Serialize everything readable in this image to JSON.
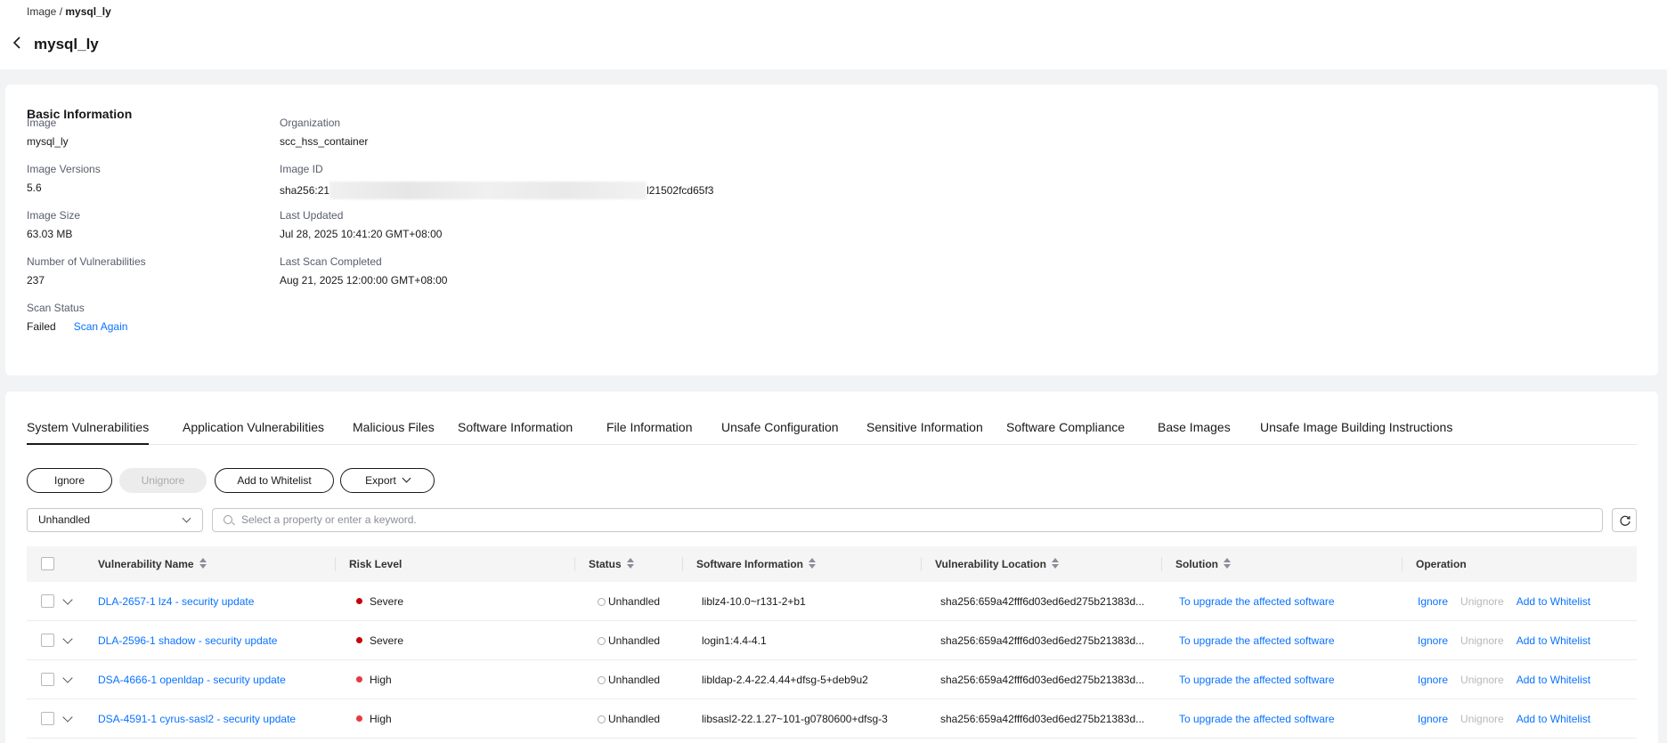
{
  "breadcrumb": {
    "parent": "Image",
    "sep": " / ",
    "current": "mysql_ly"
  },
  "page": {
    "title": "mysql_ly"
  },
  "basic_info": {
    "title": "Basic Information",
    "image": {
      "label": "Image",
      "value": "mysql_ly"
    },
    "organization": {
      "label": "Organization",
      "value": "scc_hss_container"
    },
    "image_versions": {
      "label": "Image Versions",
      "value": "5.6"
    },
    "image_id": {
      "label": "Image ID",
      "prefix": "sha256:21",
      "suffix": "l21502fcd65f3"
    },
    "image_size": {
      "label": "Image Size",
      "value": "63.03 MB"
    },
    "last_updated": {
      "label": "Last Updated",
      "value": "Jul 28, 2025 10:41:20 GMT+08:00"
    },
    "num_vulns": {
      "label": "Number of Vulnerabilities",
      "value": "237"
    },
    "last_scan": {
      "label": "Last Scan Completed",
      "value": "Aug 21, 2025 12:00:00 GMT+08:00"
    },
    "scan_status": {
      "label": "Scan Status",
      "value": "Failed",
      "action": "Scan Again"
    }
  },
  "tabs": [
    "System Vulnerabilities",
    "Application Vulnerabilities",
    "Malicious Files",
    "Software Information",
    "File Information",
    "Unsafe Configuration",
    "Sensitive Information",
    "Software Compliance",
    "Base Images",
    "Unsafe Image Building Instructions"
  ],
  "toolbar": {
    "ignore": "Ignore",
    "unignore": "Unignore",
    "whitelist": "Add to Whitelist",
    "export": "Export"
  },
  "filter": {
    "status": "Unhandled",
    "search_placeholder": "Select a property or enter a keyword."
  },
  "table": {
    "columns": {
      "name": "Vulnerability Name",
      "risk": "Risk Level",
      "status": "Status",
      "software": "Software Information",
      "location": "Vulnerability Location",
      "solution": "Solution",
      "operation": "Operation"
    },
    "rows": [
      {
        "name": "DLA-2657-1 lz4 - security update",
        "risk": "Severe",
        "status": "Unhandled",
        "software": "liblz4-10.0~r131-2+b1",
        "location": "sha256:659a42fff6d03ed6ed275b21383d...",
        "solution": "To upgrade the affected software",
        "op_ignore": "Ignore",
        "op_unignore": "Unignore",
        "op_whitelist": "Add to Whitelist"
      },
      {
        "name": "DLA-2596-1 shadow - security update",
        "risk": "Severe",
        "status": "Unhandled",
        "software": "login1:4.4-4.1",
        "location": "sha256:659a42fff6d03ed6ed275b21383d...",
        "solution": "To upgrade the affected software",
        "op_ignore": "Ignore",
        "op_unignore": "Unignore",
        "op_whitelist": "Add to Whitelist"
      },
      {
        "name": "DSA-4666-1 openldap - security update",
        "risk": "High",
        "status": "Unhandled",
        "software": "libldap-2.4-22.4.44+dfsg-5+deb9u2",
        "location": "sha256:659a42fff6d03ed6ed275b21383d...",
        "solution": "To upgrade the affected software",
        "op_ignore": "Ignore",
        "op_unignore": "Unignore",
        "op_whitelist": "Add to Whitelist"
      },
      {
        "name": "DSA-4591-1 cyrus-sasl2 - security update",
        "risk": "High",
        "status": "Unhandled",
        "software": "libsasl2-22.1.27~101-g0780600+dfsg-3",
        "location": "sha256:659a42fff6d03ed6ed275b21383d...",
        "solution": "To upgrade the affected software",
        "op_ignore": "Ignore",
        "op_unignore": "Unignore",
        "op_whitelist": "Add to Whitelist"
      }
    ]
  },
  "colors": {
    "link": "#0972ff",
    "severe": "#c7000b",
    "high": "#e8393f",
    "unhandled": "#aaaaaa"
  }
}
